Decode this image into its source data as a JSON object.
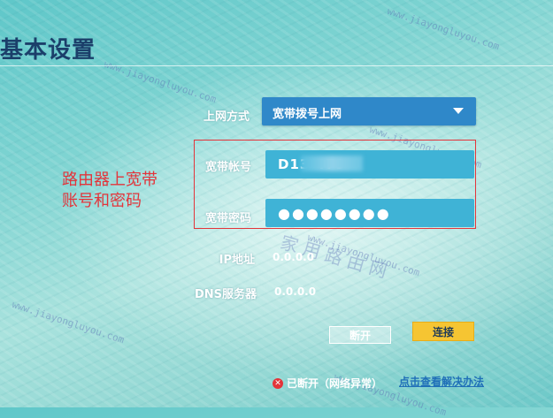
{
  "page": {
    "title": "基本设置"
  },
  "form": {
    "connection_type": {
      "label": "上网方式",
      "value": "宽带拨号上网"
    },
    "account": {
      "label": "宽带帐号",
      "value": "D13         479"
    },
    "password": {
      "label": "宽带密码",
      "value": "●●●●●●●●"
    },
    "ip": {
      "label": "IP地址",
      "value": "0.0.0.0"
    },
    "dns": {
      "label": "DNS服务器",
      "value": "0.0.0.0"
    }
  },
  "annotation": {
    "line1": "路由器上宽带",
    "line2": "账号和密码",
    "color": "#e3343a"
  },
  "buttons": {
    "disconnect": "断开",
    "connect": "连接"
  },
  "status": {
    "text": "已断开（网络异常）",
    "help_link": "点击查看解决办法"
  },
  "watermark": {
    "text": "www.jiayongluyou.com",
    "cn": "家用路由网"
  },
  "colors": {
    "title": "#1b3f6a",
    "select": "#2f88c9",
    "input": "#3fb3d6",
    "connect_button": "#f6c532",
    "annotation": "#e3343a"
  }
}
